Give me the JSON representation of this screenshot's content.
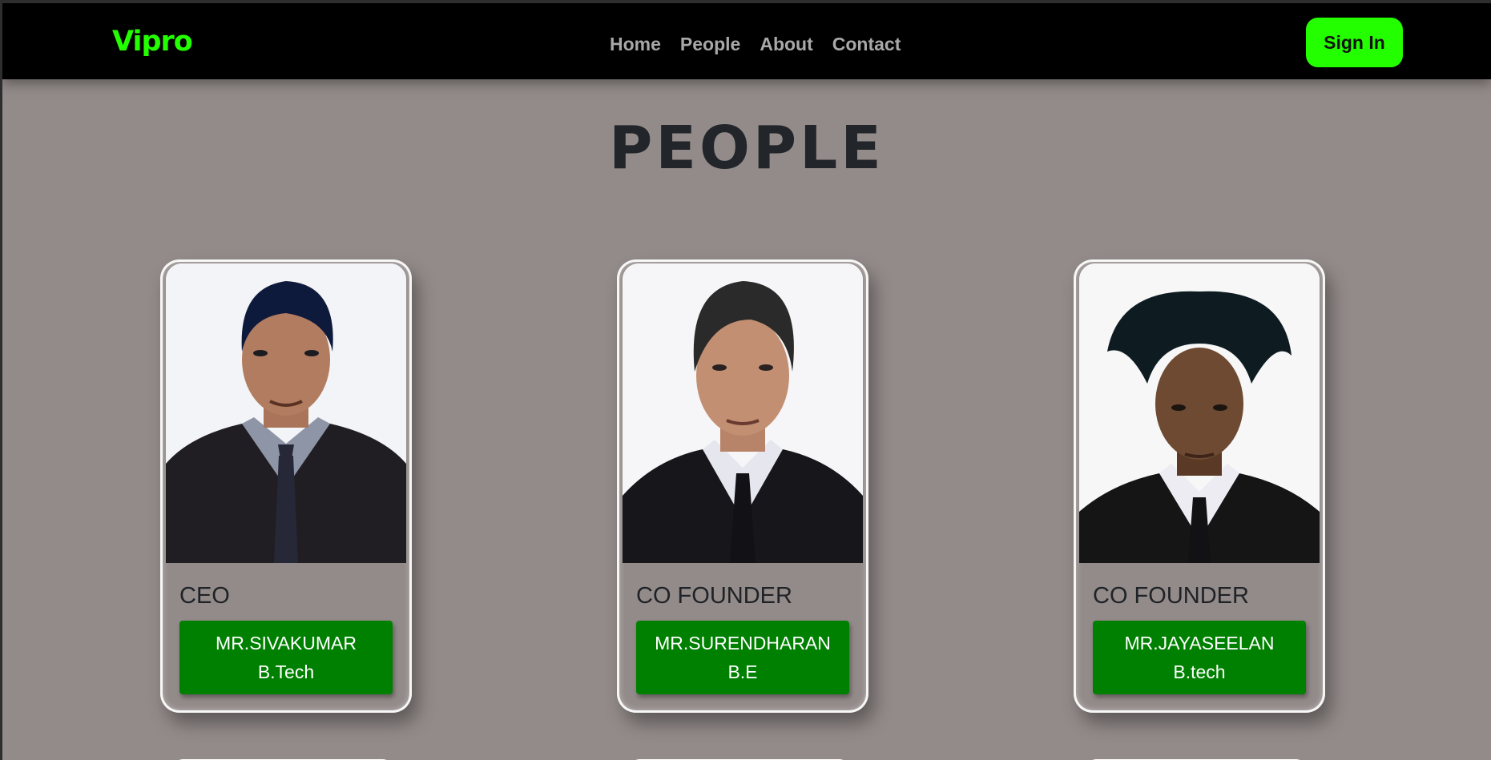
{
  "navbar": {
    "brand": "Vipro",
    "links": [
      "Home",
      "People",
      "About",
      "Contact"
    ],
    "signin_label": "Sign In"
  },
  "page": {
    "title": "PEOPLE"
  },
  "people": [
    {
      "role": "CEO",
      "name": "MR.SIVAKUMAR",
      "degree": "B.Tech"
    },
    {
      "role": "CO FOUNDER",
      "name": "MR.SURENDHARAN",
      "degree": "B.E"
    },
    {
      "role": "CO FOUNDER",
      "name": "MR.JAYASEELAN",
      "degree": "B.tech"
    }
  ],
  "colors": {
    "accent": "#24ff00",
    "navbar_bg": "#000000",
    "page_bg": "#938b8a",
    "name_button_bg": "#008000"
  }
}
